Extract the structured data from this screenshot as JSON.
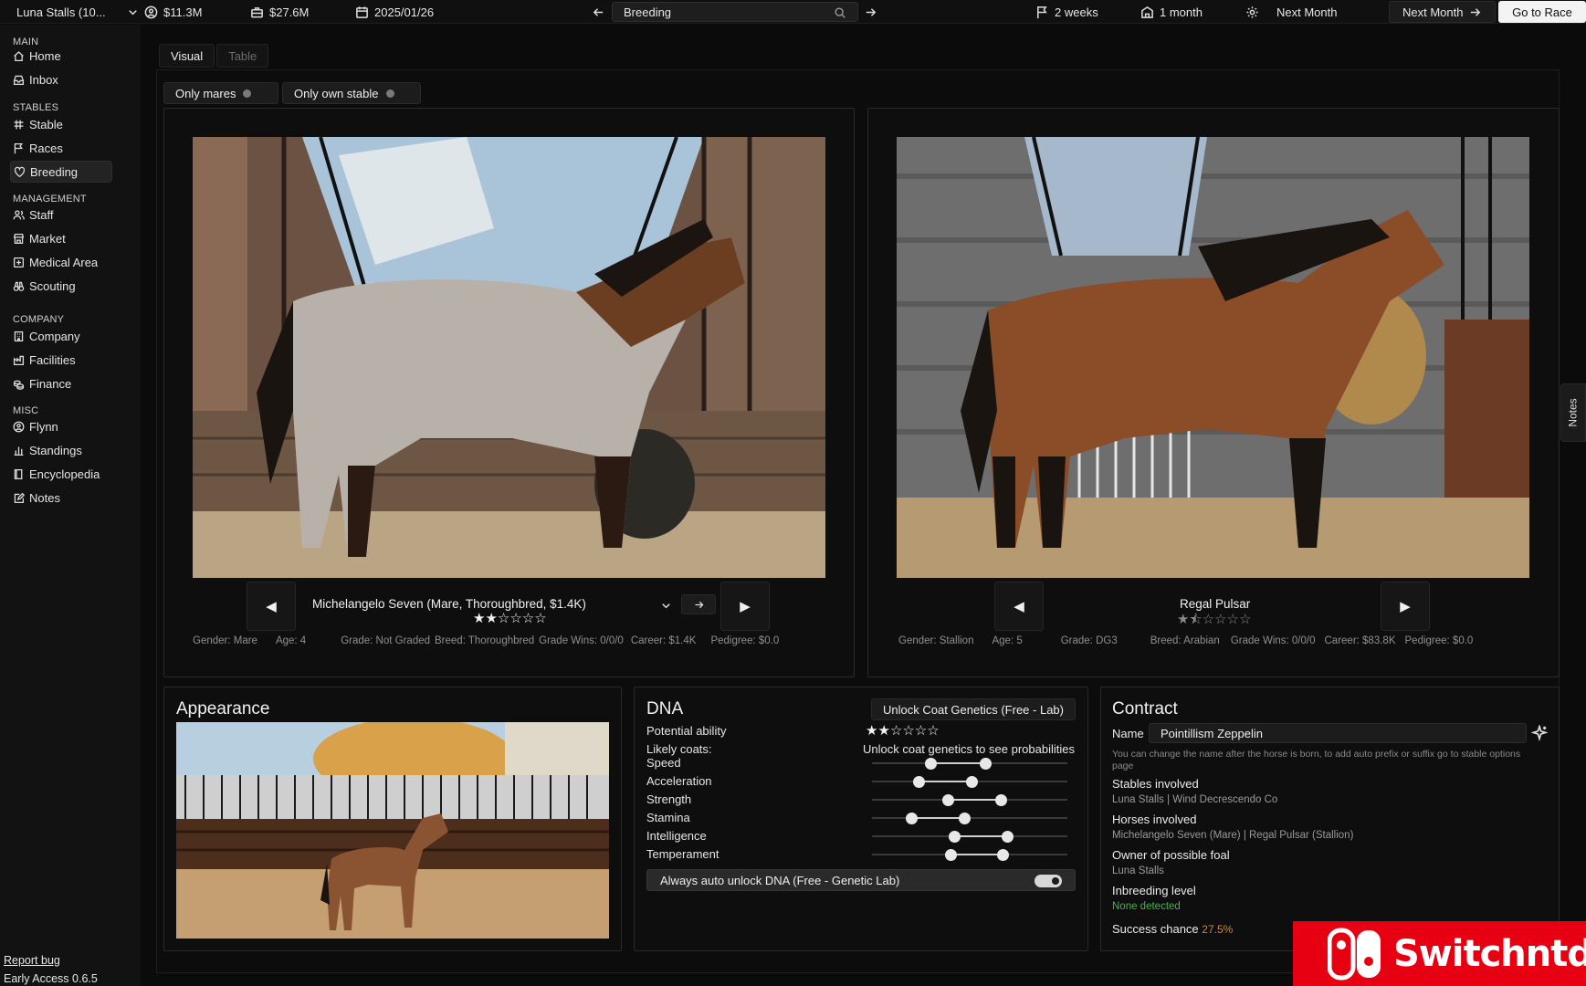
{
  "topbar": {
    "stable_name": "Luna Stalls (10...",
    "money": "$11.3M",
    "value": "$27.6M",
    "date": "2025/01/26",
    "search_value": "Breeding",
    "race_in": "2 weeks",
    "next_event": "1 month",
    "advance_option": "Next Month",
    "next_month_button": "Next Month",
    "go_to_race_button": "Go to Race"
  },
  "sidebar": {
    "sections": {
      "main": "MAIN",
      "stables": "STABLES",
      "management": "MANAGEMENT",
      "company": "COMPANY",
      "misc": "MISC"
    },
    "items": {
      "home": "Home",
      "inbox": "Inbox",
      "stable": "Stable",
      "races": "Races",
      "breeding": "Breeding",
      "staff": "Staff",
      "market": "Market",
      "medical": "Medical Area",
      "scouting": "Scouting",
      "company": "Company",
      "facilities": "Facilities",
      "finance": "Finance",
      "flynn": "Flynn",
      "standings": "Standings",
      "encyclopedia": "Encyclopedia",
      "notes": "Notes"
    },
    "report_bug": "Report bug",
    "version": "Early Access 0.6.5"
  },
  "tabs": {
    "visual": "Visual",
    "table": "Table"
  },
  "filters": {
    "only_mares": "Only mares",
    "only_own_stable": "Only own stable"
  },
  "mare": {
    "name": "Michelangelo Seven (Mare, Thoroughbred, $1.4K)",
    "stars": "★★☆☆☆☆",
    "gender": "Gender: Mare",
    "age": "Age: 4",
    "grade": "Grade: Not Graded",
    "breed": "Breed: Thoroughbred",
    "grade_wins": "Grade Wins: 0/0/0",
    "career": "Career: $1.4K",
    "pedigree": "Pedigree: $0.0"
  },
  "stallion": {
    "name": "Regal Pulsar",
    "stars": "★⯪☆☆☆☆",
    "gender": "Gender: Stallion",
    "age": "Age: 5",
    "grade": "Grade: DG3",
    "breed": "Breed: Arabian",
    "grade_wins": "Grade Wins: 0/0/0",
    "career": "Career: $83.8K",
    "pedigree": "Pedigree: $0.0"
  },
  "appearance": {
    "title": "Appearance"
  },
  "dna": {
    "title": "DNA",
    "unlock_button": "Unlock Coat Genetics (Free - Lab)",
    "potential_label": "Potential ability",
    "potential_stars": "★★☆☆☆☆",
    "coats_label": "Likely coats:",
    "coats_value": "Unlock coat genetics to see probabilities",
    "stats": [
      {
        "label": "Speed",
        "min": 0.3,
        "max": 0.58
      },
      {
        "label": "Acceleration",
        "min": 0.24,
        "max": 0.51
      },
      {
        "label": "Strength",
        "min": 0.39,
        "max": 0.66
      },
      {
        "label": "Stamina",
        "min": 0.2,
        "max": 0.47
      },
      {
        "label": "Intelligence",
        "min": 0.42,
        "max": 0.69
      },
      {
        "label": "Temperament",
        "min": 0.4,
        "max": 0.67
      }
    ],
    "auto_unlock": "Always auto unlock DNA (Free - Genetic Lab)"
  },
  "contract": {
    "title": "Contract",
    "name_label": "Name",
    "name_value": "Pointillism Zeppelin",
    "name_hint": "You can change the name after the horse is born, to add auto prefix or suffix go to stable options",
    "name_hint2": "page",
    "stables_label": "Stables involved",
    "stables_value": "Luna Stalls | Wind Decrescendo Co",
    "horses_label": "Horses involved",
    "horses_value": "Michelangelo Seven (Mare) | Regal Pulsar (Stallion)",
    "owner_label": "Owner of possible foal",
    "owner_value": "Luna Stalls",
    "inbreeding_label": "Inbreeding level",
    "inbreeding_value": "None detected",
    "success_label": "Success chance",
    "success_value": "27.5%"
  },
  "notes_tab": "Notes",
  "watermark": "Switchntd",
  "colors": {
    "accent_green": "#4caf50",
    "success_orange": "#c8854a",
    "watermark_red": "#e60012"
  }
}
